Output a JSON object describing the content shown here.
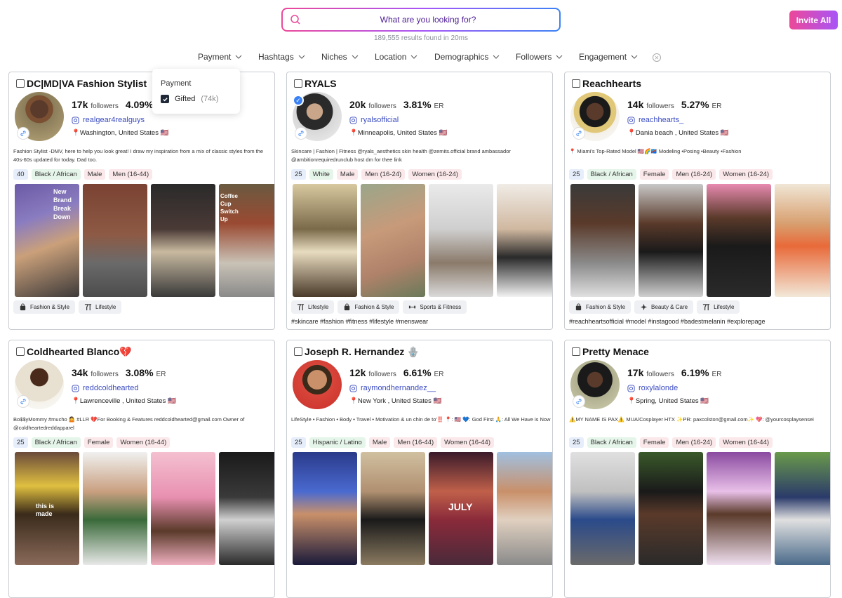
{
  "search": {
    "placeholder": "What are you looking for?",
    "results_text": "189,555 results found in 20ms"
  },
  "invite_label": "Invite All",
  "filters": [
    "Payment",
    "Hashtags",
    "Niches",
    "Location",
    "Demographics",
    "Followers",
    "Engagement"
  ],
  "payment_dropdown": {
    "title": "Payment",
    "option_label": "Gifted",
    "option_count": "(74k)",
    "checked": true
  },
  "colors": {
    "accent_pink": "#ec4899",
    "accent_purple": "#a855f7",
    "link_blue": "#3b4cc0"
  },
  "creators": [
    {
      "name": "DC|MD|VA Fashion Stylist",
      "followers": "17k",
      "followers_label": "followers",
      "er": "4.09%",
      "er_label": "ER",
      "handle": "realgear4realguys",
      "location": "📍Washington, United States 🇺🇸",
      "bio": "Fashion Stylist -DMV, here to help you look great! I draw my inspiration from a mix of classic styles from the 40s-60s updated for today. Dad too.",
      "tags": {
        "age": "40",
        "ethnicity": "Black / African",
        "gender": "Male",
        "audience1": "Men (16-44)",
        "audience2": ""
      },
      "categories": [
        "Fashion & Style",
        "Lifestyle"
      ],
      "hashtags": "",
      "verified": false
    },
    {
      "name": "RYALS",
      "followers": "20k",
      "followers_label": "followers",
      "er": "3.81%",
      "er_label": "ER",
      "handle": "ryalsofficial",
      "location": "📍Minneapolis, United States 🇺🇸",
      "bio": "Skincare | Fashion | Fitness @ryals_aesthetics skin health @zemits.official brand ambassador @ambitionrequiredrunclub host dm for thee link",
      "tags": {
        "age": "25",
        "ethnicity": "White",
        "gender": "Male",
        "audience1": "Men (16-24)",
        "audience2": "Women (16-24)"
      },
      "categories": [
        "Lifestyle",
        "Fashion & Style",
        "Sports & Fitness"
      ],
      "hashtags": "#skincare #fashion #fitness #lifestyle #menswear",
      "verified": true
    },
    {
      "name": "Reachhearts",
      "followers": "14k",
      "followers_label": "followers",
      "er": "5.27%",
      "er_label": "ER",
      "handle": "reachhearts_",
      "location": "📍Dania beach , United States 🇺🇸",
      "bio": "📍 Miami's Top-Rated Model 🇺🇸🌈🇨🇩 Modeling •Posing •Beauty •Fashion",
      "tags": {
        "age": "25",
        "ethnicity": "Black / African",
        "gender": "Female",
        "audience1": "Men (16-24)",
        "audience2": "Women (16-24)"
      },
      "categories": [
        "Fashion & Style",
        "Beauty & Care",
        "Lifestyle"
      ],
      "hashtags": "#reachheartsofficial #model #instagood #badestmelanin #explorepage",
      "verified": false
    },
    {
      "name": "Coldhearted Blanco💔",
      "followers": "34k",
      "followers_label": "followers",
      "er": "3.08%",
      "er_label": "ER",
      "handle": "reddcoldhearted",
      "location": "📍Lawrenceville , United States 🇺🇸",
      "bio": "Bo$$yMommy #mucho 🤷 #LLR 💔For Booking & Features reddcoldhearted@gmail.com Owner of @coldheartedreddapparel",
      "tags": {
        "age": "25",
        "ethnicity": "Black / African",
        "gender": "Female",
        "audience1": "Women (16-44)",
        "audience2": ""
      },
      "categories": [],
      "hashtags": "",
      "verified": false
    },
    {
      "name": "Joseph R. Hernandez 🪬",
      "followers": "12k",
      "followers_label": "followers",
      "er": "6.61%",
      "er_label": "ER",
      "handle": "raymondhernandez__",
      "location": "📍New York , United States 🇺🇸",
      "bio": "LifeStyle • Fashion • Body • Travel • Motivation & un chin de to'‼️ 📍: 🇺🇸 💙: God First 🙏: All We Have is Now",
      "tags": {
        "age": "25",
        "ethnicity": "Hispanic / Latino",
        "gender": "Male",
        "audience1": "Men (16-44)",
        "audience2": "Women (16-44)"
      },
      "categories": [],
      "hashtags": "",
      "verified": false
    },
    {
      "name": "Pretty Menace",
      "followers": "17k",
      "followers_label": "followers",
      "er": "6.19%",
      "er_label": "ER",
      "handle": "roxylalonde",
      "location": "📍Spring, United States 🇺🇸",
      "bio": "⚠️MY NAME IS PAX⚠️ MUA/Cosplayer HTX ✨PR: paxcolston@gmail.com✨ 💖: @yourcosplaysensei",
      "tags": {
        "age": "25",
        "ethnicity": "Black / African",
        "gender": "Female",
        "audience1": "Men (16-24)",
        "audience2": "Women (16-44)"
      },
      "categories": [],
      "hashtags": "",
      "verified": false
    }
  ],
  "photo_overlay_text": {
    "card0_photo0": "New Brand Break Down",
    "card0_photo3": "Coffee Cup Switch Up",
    "card3_photo0": "this is made",
    "card4_photo2": "JULY"
  }
}
